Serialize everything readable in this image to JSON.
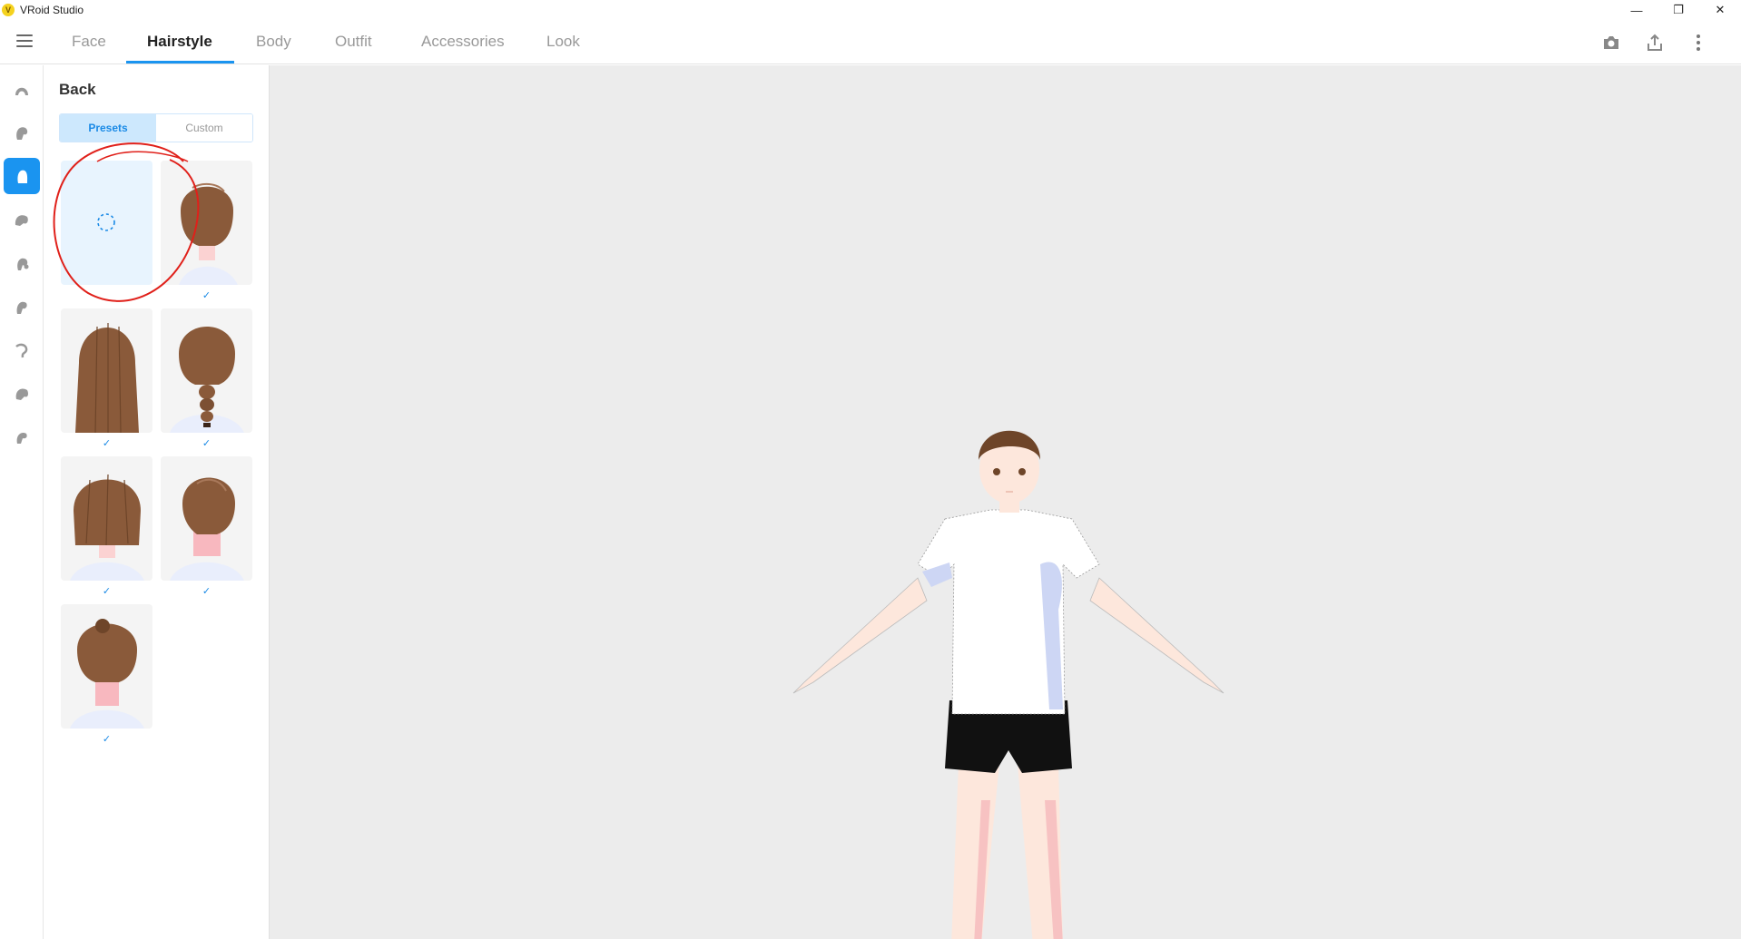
{
  "window": {
    "title": "VRoid Studio",
    "logo_letter": "V",
    "minimize": "—",
    "restore": "❐",
    "close": "✕"
  },
  "nav": {
    "tabs": [
      {
        "label": "Face"
      },
      {
        "label": "Hairstyle"
      },
      {
        "label": "Body"
      },
      {
        "label": "Outfit"
      },
      {
        "label": "Accessories"
      },
      {
        "label": "Look"
      }
    ],
    "active_tab": "Hairstyle",
    "tools": [
      "camera-icon",
      "export-icon",
      "more-vertical-icon"
    ]
  },
  "rail": {
    "items": [
      "hair-front-icon",
      "hair-side-icon",
      "hair-back-icon",
      "hair-ahoge-icon",
      "hair-tail-icon",
      "hair-extra-icon",
      "hair-curl-icon",
      "hair-full-icon",
      "hair-base-icon"
    ],
    "active_index": 2
  },
  "panel": {
    "title": "Back",
    "tabs": {
      "presets": "Presets",
      "custom": "Custom"
    },
    "active_tab": "Presets",
    "presets": [
      {
        "name": "none",
        "check": ""
      },
      {
        "name": "short-bob",
        "check": "✓"
      },
      {
        "name": "long-straight",
        "check": "✓"
      },
      {
        "name": "braid",
        "check": "✓"
      },
      {
        "name": "bob-layered",
        "check": "✓"
      },
      {
        "name": "side-swept",
        "check": "✓"
      },
      {
        "name": "bun",
        "check": "✓"
      }
    ]
  },
  "colors": {
    "accent": "#1a94f0",
    "annotation": "#e0201a",
    "viewport_bg": "#ececec",
    "hair": "#8a5a3a"
  }
}
